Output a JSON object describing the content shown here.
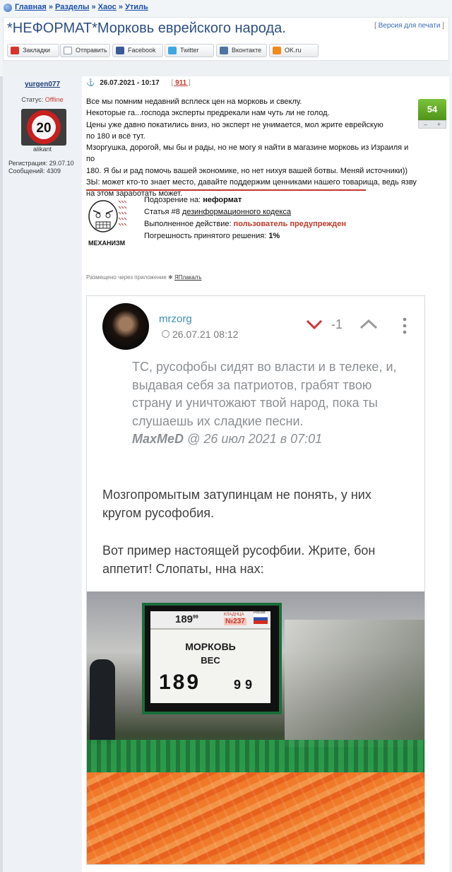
{
  "breadcrumbs": {
    "home": "Главная",
    "sep": "»",
    "section": "Разделы",
    "chaos": "Хаос",
    "util": "Утиль"
  },
  "title": "*НЕФОРМАТ*Морковь еврейского народа.",
  "print_link": "Версия для печати",
  "share_buttons": [
    {
      "label": "Закладки",
      "icon": "yaplakal-icon",
      "color": "#d9342b"
    },
    {
      "label": "Отправить",
      "icon": "mail-icon",
      "color": "#8a98a8"
    },
    {
      "label": "Facebook",
      "icon": "facebook-icon",
      "color": "#3b5998"
    },
    {
      "label": "Twitter",
      "icon": "twitter-icon",
      "color": "#3ea7e0"
    },
    {
      "label": "Вконтакте",
      "icon": "vk-icon",
      "color": "#4c75a3"
    },
    {
      "label": "OK.ru",
      "icon": "ok-icon",
      "color": "#f28a1a"
    }
  ],
  "user": {
    "name": "yurgen077",
    "status_label": "Статус:",
    "status_value": "Offline",
    "avatar_text": "20",
    "location": "alikant",
    "registration": "Регистрация: 29.07.10",
    "messages": "Сообщений: 4309"
  },
  "post": {
    "date": "26.07.2021 - 10:17",
    "comments": "911",
    "lines": [
      "Все мы помним недавний всплеск цен на морковь и свеклу.",
      "Некоторые га...господа эксперты предрекали нам чуть ли не голод.",
      "Цены уже давно покатились вниз, но эксперт не унимается, мол жрите еврейскую",
      "по 180 и всё тут.",
      "Мзоргушка, дорогой, мы бы и рады, но не могу я найти в магазине морковь из Израиля и по",
      "180. Я бы и рад помочь вашей экономике, но нет нихуя вашей ботвы. Меняй источники))",
      "ЗЫ: может кто-то знает место, давайте поддержим ценниками нашего товарища, ведь язву",
      "на этом заработать может."
    ],
    "rating": "54",
    "minus": "–",
    "plus": "+"
  },
  "mechanism": {
    "label": "МЕХАНИЗМ",
    "suspicion_label": "Подозрение на:",
    "suspicion_value": "неформат",
    "article_label": "Статья #8",
    "article_link": "дезинформационного кодекса",
    "action_label": "Выполненное действие:",
    "action_value": "пользователь предупрежден",
    "error_label": "Погрешность принятого решения:",
    "error_value": "1%"
  },
  "via": {
    "text": "Размещено через приложение",
    "app": "ЯПлакалъ"
  },
  "screenshot": {
    "username": "mrzorg",
    "date": "26.07.21 08:12",
    "score": "-1",
    "quote": "ТС, русофобы сидят во власти и в телеке, и, выдавая себя за патриотов, грабят твою страну и уничтожают твой народ, пока ты слушаешь их сладкие песни.",
    "quote_author": "MaxMeD",
    "quote_date": "@ 26 июл 2021 в 07:01",
    "reply1": "Мозгопромытым затупинцам не понять, у них кругом русофобия.",
    "reply2": "Вот пример настоящей русофбии. Жрите, бон аппетит! Слопаты, нна нах:"
  },
  "price_tag": {
    "small_price": "189",
    "small_cents": "99",
    "shelf_label": "КЛАДНЦА",
    "shelf_num": "№237",
    "country": "Россия",
    "name": "МОРКОВЬ",
    "unit": "ВЕС",
    "price": "189",
    "cents": "99"
  }
}
